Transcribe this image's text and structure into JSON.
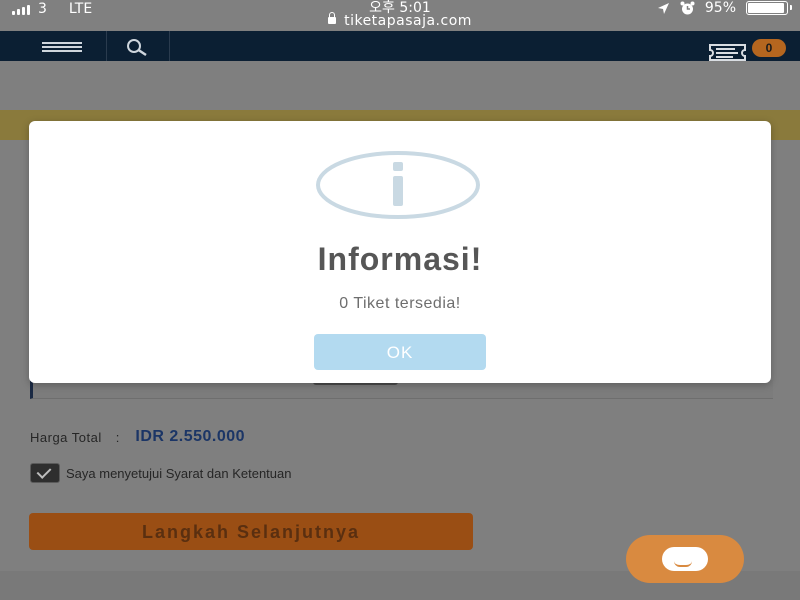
{
  "status_bar": {
    "carrier": "3",
    "network": "LTE",
    "time": "오후 5:01",
    "url": "tiketapasaja.com",
    "battery_percent": "95%",
    "battery_level": 0.95
  },
  "navbar": {
    "menu_icon": "hamburger-icon",
    "search_icon": "search-icon",
    "cart_icon": "ticket-icon",
    "cart_count": "0"
  },
  "page": {
    "total_label": "Harga Total",
    "total_colon": ":",
    "total_value": "IDR 2.550.000",
    "agree_checked": true,
    "agree_text": "Saya menyetujui Syarat dan Ketentuan",
    "next_button": "Langkah Selanjutnya",
    "chat_icon": "chat-icon"
  },
  "modal": {
    "icon": "info-icon",
    "title": "Informasi!",
    "message": "0 Tiket tersedia!",
    "ok_button": "OK"
  },
  "colors": {
    "navbar": "#0b1f33",
    "accent_orange": "#d98a40",
    "ok_button": "#b3daf0",
    "total_value": "#1b3566"
  }
}
